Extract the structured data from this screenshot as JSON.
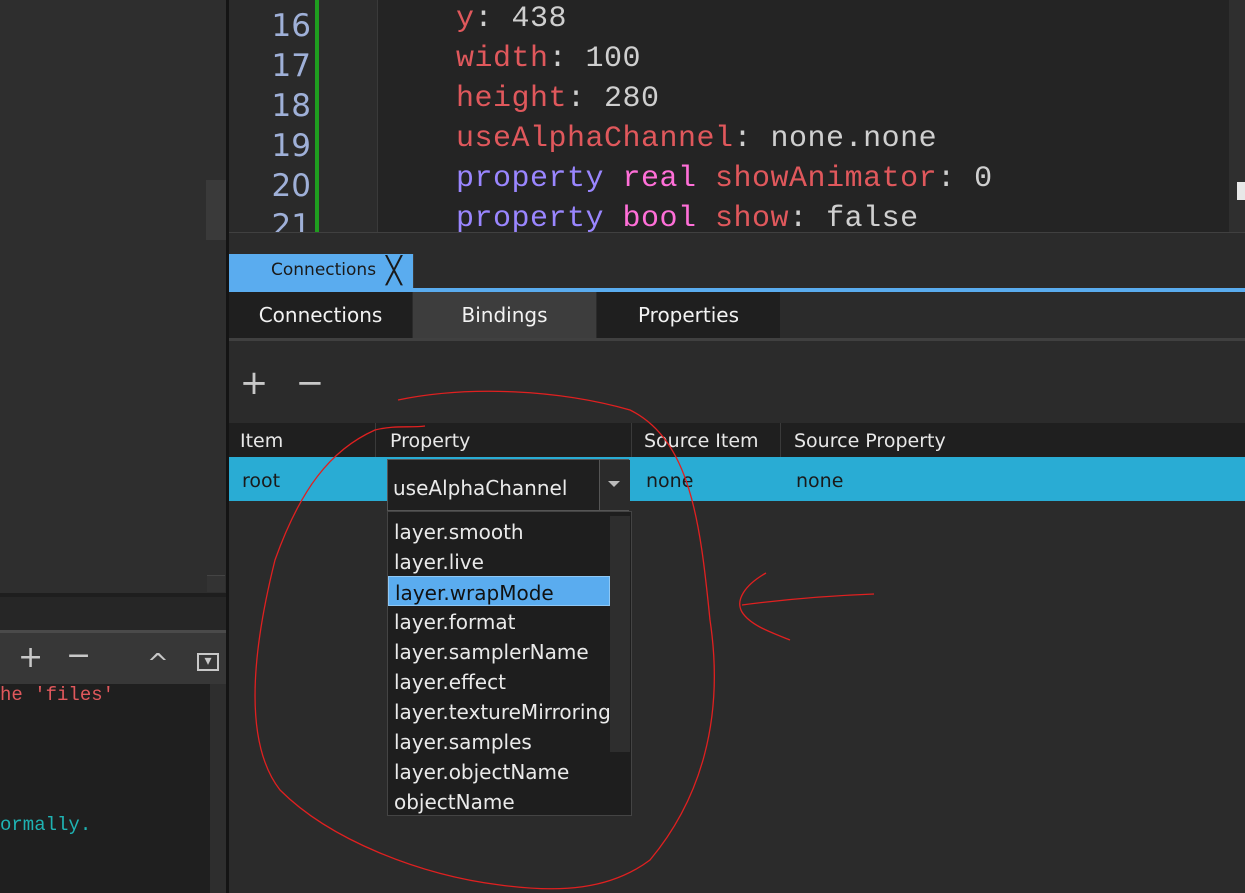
{
  "editor": {
    "lines": [
      {
        "num": "16",
        "tokens": [
          {
            "t": "y",
            "c": "red"
          },
          {
            "t": ": 438",
            "c": "plain"
          }
        ]
      },
      {
        "num": "17",
        "tokens": [
          {
            "t": "width",
            "c": "red"
          },
          {
            "t": ": 100",
            "c": "plain"
          }
        ]
      },
      {
        "num": "18",
        "tokens": [
          {
            "t": "height",
            "c": "red"
          },
          {
            "t": ": 280",
            "c": "plain"
          }
        ]
      },
      {
        "num": "19",
        "tokens": [
          {
            "t": "useAlphaChannel",
            "c": "red"
          },
          {
            "t": ": none.none",
            "c": "plain"
          }
        ]
      },
      {
        "num": "20",
        "tokens": [
          {
            "t": "property ",
            "c": "purple"
          },
          {
            "t": "real ",
            "c": "pink"
          },
          {
            "t": "showAnimator",
            "c": "red"
          },
          {
            "t": ": 0",
            "c": "plain"
          }
        ]
      },
      {
        "num": "21",
        "tokens": [
          {
            "t": "property ",
            "c": "purple"
          },
          {
            "t": "bool ",
            "c": "pink"
          },
          {
            "t": "show",
            "c": "red"
          },
          {
            "t": ": false",
            "c": "plain"
          }
        ]
      }
    ]
  },
  "left_console": {
    "line1": "he 'files'",
    "line2": "ormally."
  },
  "left_toolbar": {
    "add": "+",
    "remove": "−",
    "up": "^",
    "menu": "▾"
  },
  "dock_tab": {
    "label": "Connections",
    "close": "╳"
  },
  "subtabs": {
    "connections": "Connections",
    "bindings": "Bindings",
    "properties": "Properties"
  },
  "toolbar": {
    "add": "+",
    "remove": "−"
  },
  "table": {
    "headers": {
      "item": "Item",
      "property": "Property",
      "source_item": "Source Item",
      "source_property": "Source Property"
    },
    "row": {
      "item": "root",
      "property": "useAlphaChannel",
      "source_item": "none",
      "source_property": "none"
    }
  },
  "dropdown": {
    "options": [
      "layer.smooth",
      "layer.live",
      "layer.wrapMode",
      "layer.format",
      "layer.samplerName",
      "layer.effect",
      "layer.textureMirroring",
      "layer.samples",
      "layer.objectName",
      "objectName"
    ],
    "highlighted": "layer.wrapMode"
  },
  "colors": {
    "accent": "#5aacef",
    "row_selected": "#29acd4",
    "annotation": "#e02020"
  }
}
